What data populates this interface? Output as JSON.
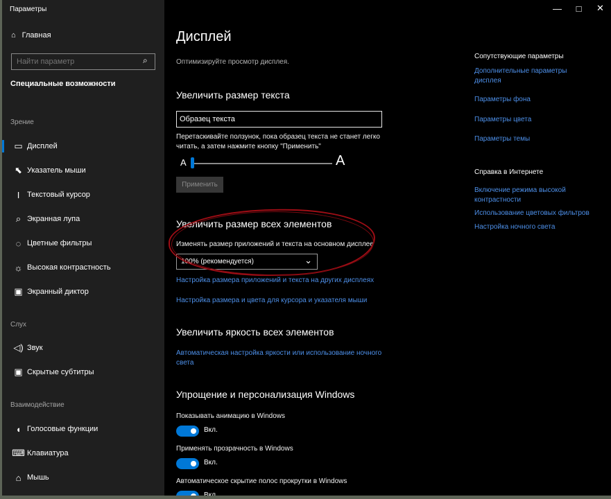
{
  "window": {
    "title": "Параметры",
    "controls": [
      "—",
      "□",
      "✕"
    ]
  },
  "sidebar": {
    "home": "Главная",
    "search": {
      "placeholder": "Найти параметр"
    },
    "category": "Специальные возможности",
    "sections": [
      {
        "title": "Зрение",
        "items": [
          {
            "label": "Дисплей",
            "icon": "display-icon",
            "glyph": "▭",
            "active": true
          },
          {
            "label": "Указатель мыши",
            "icon": "mouse-pointer-icon",
            "glyph": "⬉"
          },
          {
            "label": "Текстовый курсор",
            "icon": "text-cursor-icon",
            "glyph": "I"
          },
          {
            "label": "Экранная лупа",
            "icon": "magnifier-icon",
            "glyph": "⌕"
          },
          {
            "label": "Цветные фильтры",
            "icon": "color-filter-icon",
            "glyph": "◌"
          },
          {
            "label": "Высокая контрастность",
            "icon": "high-contrast-icon",
            "glyph": "☼"
          },
          {
            "label": "Экранный диктор",
            "icon": "narrator-icon",
            "glyph": "▣"
          }
        ]
      },
      {
        "title": "Слух",
        "items": [
          {
            "label": "Звук",
            "icon": "sound-icon",
            "glyph": "◁)"
          },
          {
            "label": "Скрытые субтитры",
            "icon": "closed-captions-icon",
            "glyph": "▣"
          }
        ]
      },
      {
        "title": "Взаимодействие",
        "items": [
          {
            "label": "Голосовые функции",
            "icon": "speech-icon",
            "glyph": "◖"
          },
          {
            "label": "Клавиатура",
            "icon": "keyboard-icon",
            "glyph": "⌨"
          },
          {
            "label": "Мышь",
            "icon": "mouse-icon",
            "glyph": "⌂"
          }
        ]
      }
    ]
  },
  "main": {
    "title": "Дисплей",
    "subtitle": "Оптимизируйте просмотр дисплея.",
    "text_size": {
      "heading": "Увеличить размер текста",
      "sample": "Образец текста",
      "description_line1": "Перетаскивайте ползунок, пока образец текста не станет легко",
      "description_line2": "читать, а затем нажмите кнопку \"Применить\"",
      "small_a": "A",
      "large_a": "A",
      "slider_value_percent": 0,
      "apply": "Применить"
    },
    "all_elements": {
      "heading": "Увеличить размер всех элементов",
      "label": "Изменять размер приложений и текста на основном дисплее",
      "selected": "100% (рекомендуется)",
      "link1": "Настройка размера приложений и текста на других дисплеях",
      "link2": "Настройка размера и цвета для курсора и указателя мыши"
    },
    "brightness": {
      "heading": "Увеличить яркость всех элементов",
      "link_line1": "Автоматическая настройка яркости или использование ночного",
      "link_line2": "света"
    },
    "personalization": {
      "heading": "Упрощение и персонализация Windows",
      "settings": [
        {
          "label": "Показывать анимацию в Windows",
          "state": "Вкл."
        },
        {
          "label": "Применять прозрачность в Windows",
          "state": "Вкл."
        },
        {
          "label": "Автоматическое скрытие полос прокрутки в Windows",
          "state": "Вкл."
        }
      ]
    }
  },
  "right_panel": {
    "related": {
      "heading": "Сопутствующие параметры",
      "links": [
        "Дополнительные параметры дисплея",
        "Параметры фона",
        "Параметры цвета",
        "Параметры темы"
      ],
      "link1_line1": "Дополнительные параметры",
      "link1_line2": "дисплея"
    },
    "online_help": {
      "heading": "Справка в Интернете",
      "link1_line1": "Включение режима высокой",
      "link1_line2": "контрастности",
      "link2": "Использование цветовых фильтров",
      "link3": "Настройка ночного света"
    }
  },
  "colors": {
    "accent": "#0078d7",
    "link": "#4d8fe8",
    "annotation": "#a00d15",
    "background": "#000000",
    "sidebar": "#1f1f1f"
  }
}
